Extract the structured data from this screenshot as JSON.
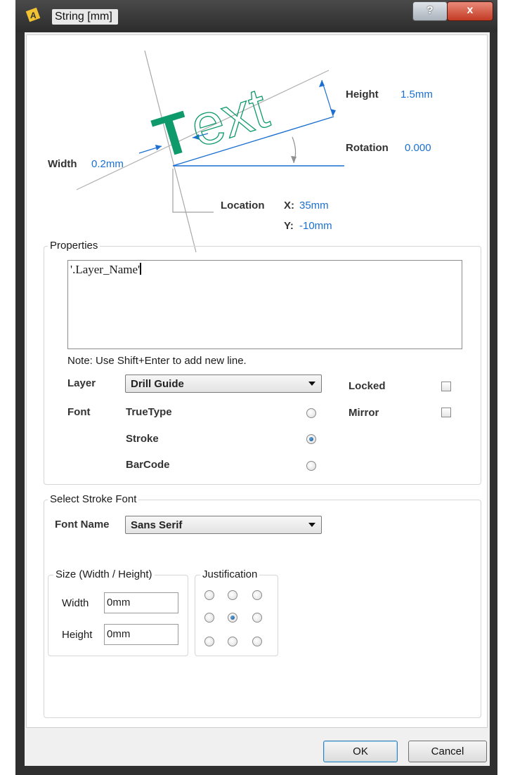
{
  "window": {
    "title": "String [mm]",
    "help_label": "?",
    "close_label": "x"
  },
  "diagram": {
    "sample_text": "Text",
    "height_label": "Height",
    "height_value": "1.5mm",
    "rotation_label": "Rotation",
    "rotation_value": "0.000",
    "width_label": "Width",
    "width_value": "0.2mm",
    "location_label": "Location",
    "x_label": "X:",
    "x_value": "35mm",
    "y_label": "Y:",
    "y_value": "-10mm",
    "colors": {
      "accent": "#1a6fd1",
      "text_fill": "#0e9a6a"
    }
  },
  "properties": {
    "legend": "Properties",
    "text_value": "'.Layer_Name'",
    "note": "Note: Use Shift+Enter to add new line.",
    "layer_label": "Layer",
    "layer_value": "Drill Guide",
    "font_label": "Font",
    "font_options": [
      "TrueType",
      "Stroke",
      "BarCode"
    ],
    "font_selected": "Stroke",
    "locked_label": "Locked",
    "locked_checked": false,
    "mirror_label": "Mirror",
    "mirror_checked": false
  },
  "stroke_font": {
    "legend": "Select Stroke Font",
    "font_name_label": "Font Name",
    "font_name_value": "Sans Serif",
    "size_legend": "Size (Width / Height)",
    "width_label": "Width",
    "width_value": "0mm",
    "height_label": "Height",
    "height_value": "0mm",
    "justification_legend": "Justification",
    "justification_selected": "center"
  },
  "buttons": {
    "ok": "OK",
    "cancel": "Cancel"
  }
}
